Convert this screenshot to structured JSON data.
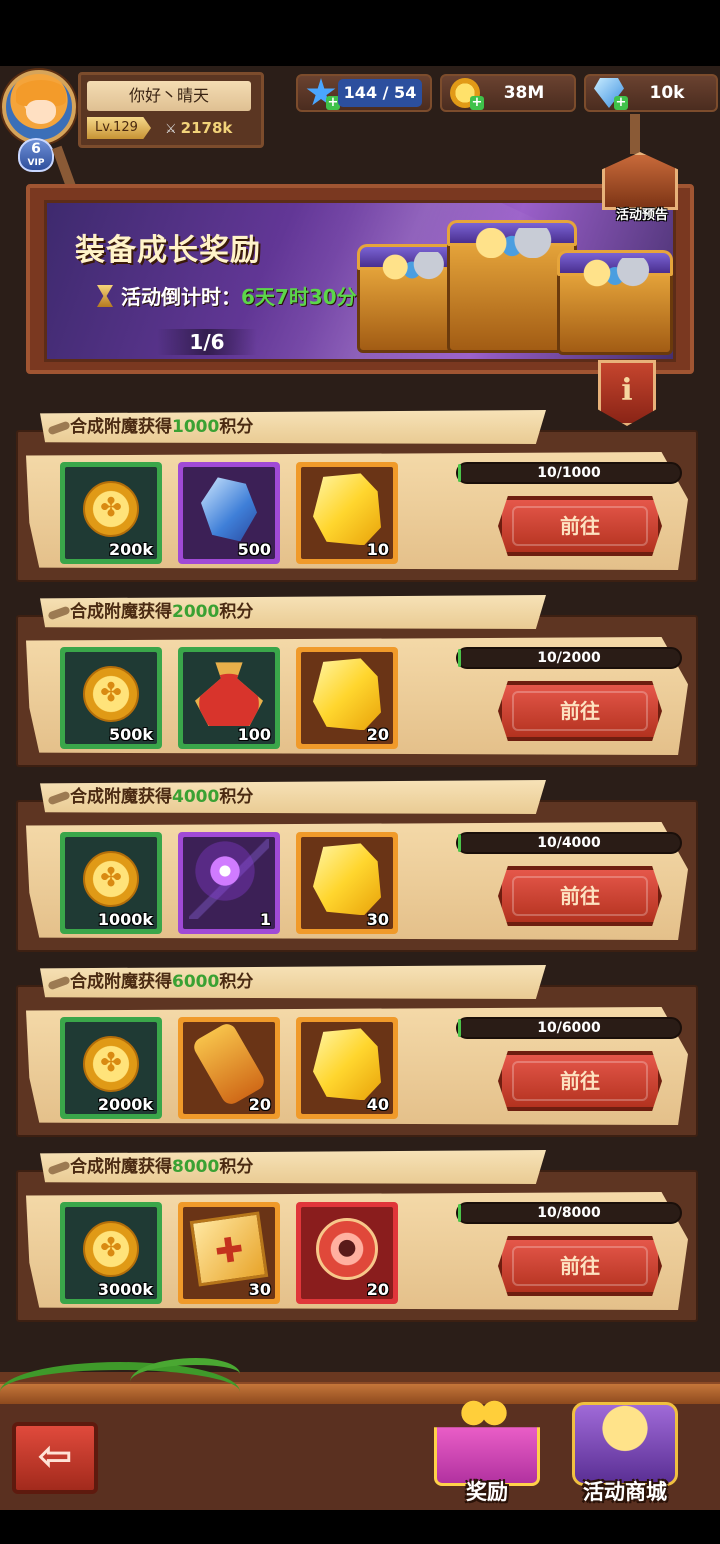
{
  "player": {
    "name": "你好丶晴天",
    "level": "Lv.129",
    "power": "2178k",
    "vip_level": "6",
    "vip_label": "VIP"
  },
  "resources": {
    "energy": "144 / 54",
    "gold": "38M",
    "diamonds": "10k"
  },
  "preview_label": "活动预告",
  "banner": {
    "title": "装备成长奖励",
    "countdown_label": "活动倒计时：",
    "countdown_value": "6天7时30分",
    "page": "1/6"
  },
  "info_icon": "i",
  "go_label": "前往",
  "tasks": [
    {
      "prefix": "合成附魔获得",
      "points": "1000",
      "suffix": "积分",
      "progress_text": "10/1000",
      "progress_fraction": 0.01,
      "rewards": [
        {
          "icon": "gold-coin",
          "frame": "green",
          "qty": "200k"
        },
        {
          "icon": "blue-crystal",
          "frame": "purple",
          "qty": "500"
        },
        {
          "icon": "gold-ore",
          "frame": "orange",
          "qty": "10"
        }
      ]
    },
    {
      "prefix": "合成附魔获得",
      "points": "2000",
      "suffix": "积分",
      "progress_text": "10/2000",
      "progress_fraction": 0.005,
      "rewards": [
        {
          "icon": "gold-coin",
          "frame": "green",
          "qty": "500k"
        },
        {
          "icon": "loot-bag",
          "frame": "green",
          "qty": "100"
        },
        {
          "icon": "gold-ore",
          "frame": "orange",
          "qty": "20"
        }
      ]
    },
    {
      "prefix": "合成附魔获得",
      "points": "4000",
      "suffix": "积分",
      "progress_text": "10/4000",
      "progress_fraction": 0.0025,
      "rewards": [
        {
          "icon": "gold-coin",
          "frame": "green",
          "qty": "1000k"
        },
        {
          "icon": "magic-staff",
          "frame": "purple",
          "qty": "1"
        },
        {
          "icon": "gold-ore",
          "frame": "orange",
          "qty": "30"
        }
      ]
    },
    {
      "prefix": "合成附魔获得",
      "points": "6000",
      "suffix": "积分",
      "progress_text": "10/6000",
      "progress_fraction": 0.0017,
      "rewards": [
        {
          "icon": "gold-coin",
          "frame": "green",
          "qty": "2000k"
        },
        {
          "icon": "scroll",
          "frame": "orange",
          "qty": "20"
        },
        {
          "icon": "gold-ore",
          "frame": "orange",
          "qty": "40"
        }
      ]
    },
    {
      "prefix": "合成附魔获得",
      "points": "8000",
      "suffix": "积分",
      "progress_text": "10/8000",
      "progress_fraction": 0.0013,
      "rewards": [
        {
          "icon": "gold-coin",
          "frame": "green",
          "qty": "3000k"
        },
        {
          "icon": "spell-book",
          "frame": "orange",
          "qty": "30"
        },
        {
          "icon": "paw-token",
          "frame": "red",
          "qty": "20"
        }
      ]
    }
  ],
  "footer": {
    "back_icon": "⇦",
    "rewards_tab": "奖励",
    "shop_tab": "活动商城"
  },
  "colors": {
    "points_green": "#3aa133",
    "countdown_green": "#5cd64a",
    "button_red": "#c8402e"
  }
}
